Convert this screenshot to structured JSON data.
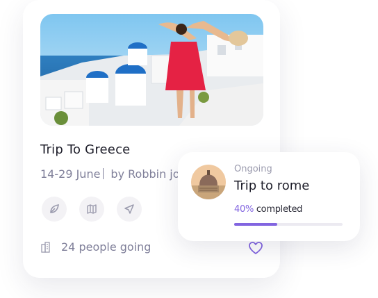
{
  "trip_card": {
    "title": "Trip To Greece",
    "dates": "14-29 June",
    "author": "by Robbin jo",
    "actions": [
      {
        "name": "leaf-icon"
      },
      {
        "name": "map-icon"
      },
      {
        "name": "send-icon"
      }
    ],
    "people_going": "24 people going",
    "building_icon": "building-icon",
    "favorite_icon": "heart-icon"
  },
  "ongoing_popup": {
    "status": "Ongoing",
    "trip_name": "Trip to rome",
    "progress_percent": "40%",
    "progress_label": " completed",
    "progress_value": 0.4
  },
  "colors": {
    "accent": "#8265e0",
    "text_dark": "#1e1e2a",
    "text_muted": "#80809a",
    "icon_bg": "#f3f2f5"
  }
}
